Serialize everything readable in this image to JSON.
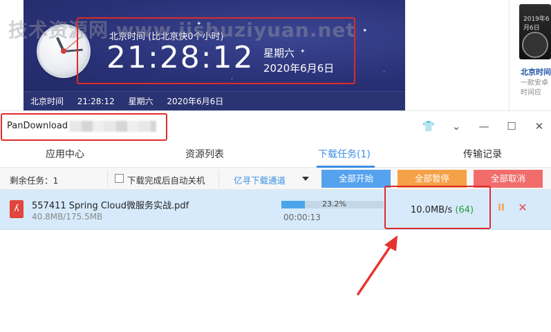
{
  "watermark": "技术资源网 www.jishuziyuan.net",
  "clock": {
    "subtitle": "北京时间 (比北京快0个小时)",
    "time": "21:28:12",
    "weekday": "星期六",
    "date": "2020年6月6日",
    "footer": {
      "label": "北京时间",
      "time": "21:28:12",
      "weekday": "星期六",
      "date": "2020年6月6日"
    }
  },
  "ad": {
    "thumb_text": "2019年6月6日",
    "title": "北京时间",
    "desc_line1": "一款安卓",
    "desc_line2": "时间应"
  },
  "window": {
    "title": "PanDownload",
    "controls": {
      "skin": "👕",
      "menu": "⌄",
      "minimize": "—",
      "maximize": "☐",
      "close": "✕"
    }
  },
  "tabs": [
    {
      "label": "应用中心"
    },
    {
      "label": "资源列表"
    },
    {
      "label": "下载任务(1)"
    },
    {
      "label": "传输记录"
    }
  ],
  "toolbar": {
    "remaining": "剩余任务：1",
    "auto_shutdown_label": "下载完成后自动关机",
    "channel": "亿寻下载通道",
    "start_all": "全部开始",
    "pause_all": "全部暂停",
    "cancel_all": "全部取消"
  },
  "task": {
    "icon": "pdf-icon",
    "file_name": "557411 Spring Cloud微服务实战.pdf",
    "size": "40.8MB/175.5MB",
    "progress_percent": 23.2,
    "progress_label": "23.2%",
    "elapsed": "00:00:13",
    "speed": "10.0MB/s",
    "connections": "(64)",
    "pause_glyph": "II",
    "close_glyph": "✕"
  },
  "colors": {
    "accent": "#3a8ee6",
    "highlight": "#e02a2a",
    "start_btn": "#55a3ee",
    "pause_btn": "#f5a147",
    "cancel_btn": "#f26c6c",
    "row_bg": "#d6eafb"
  }
}
